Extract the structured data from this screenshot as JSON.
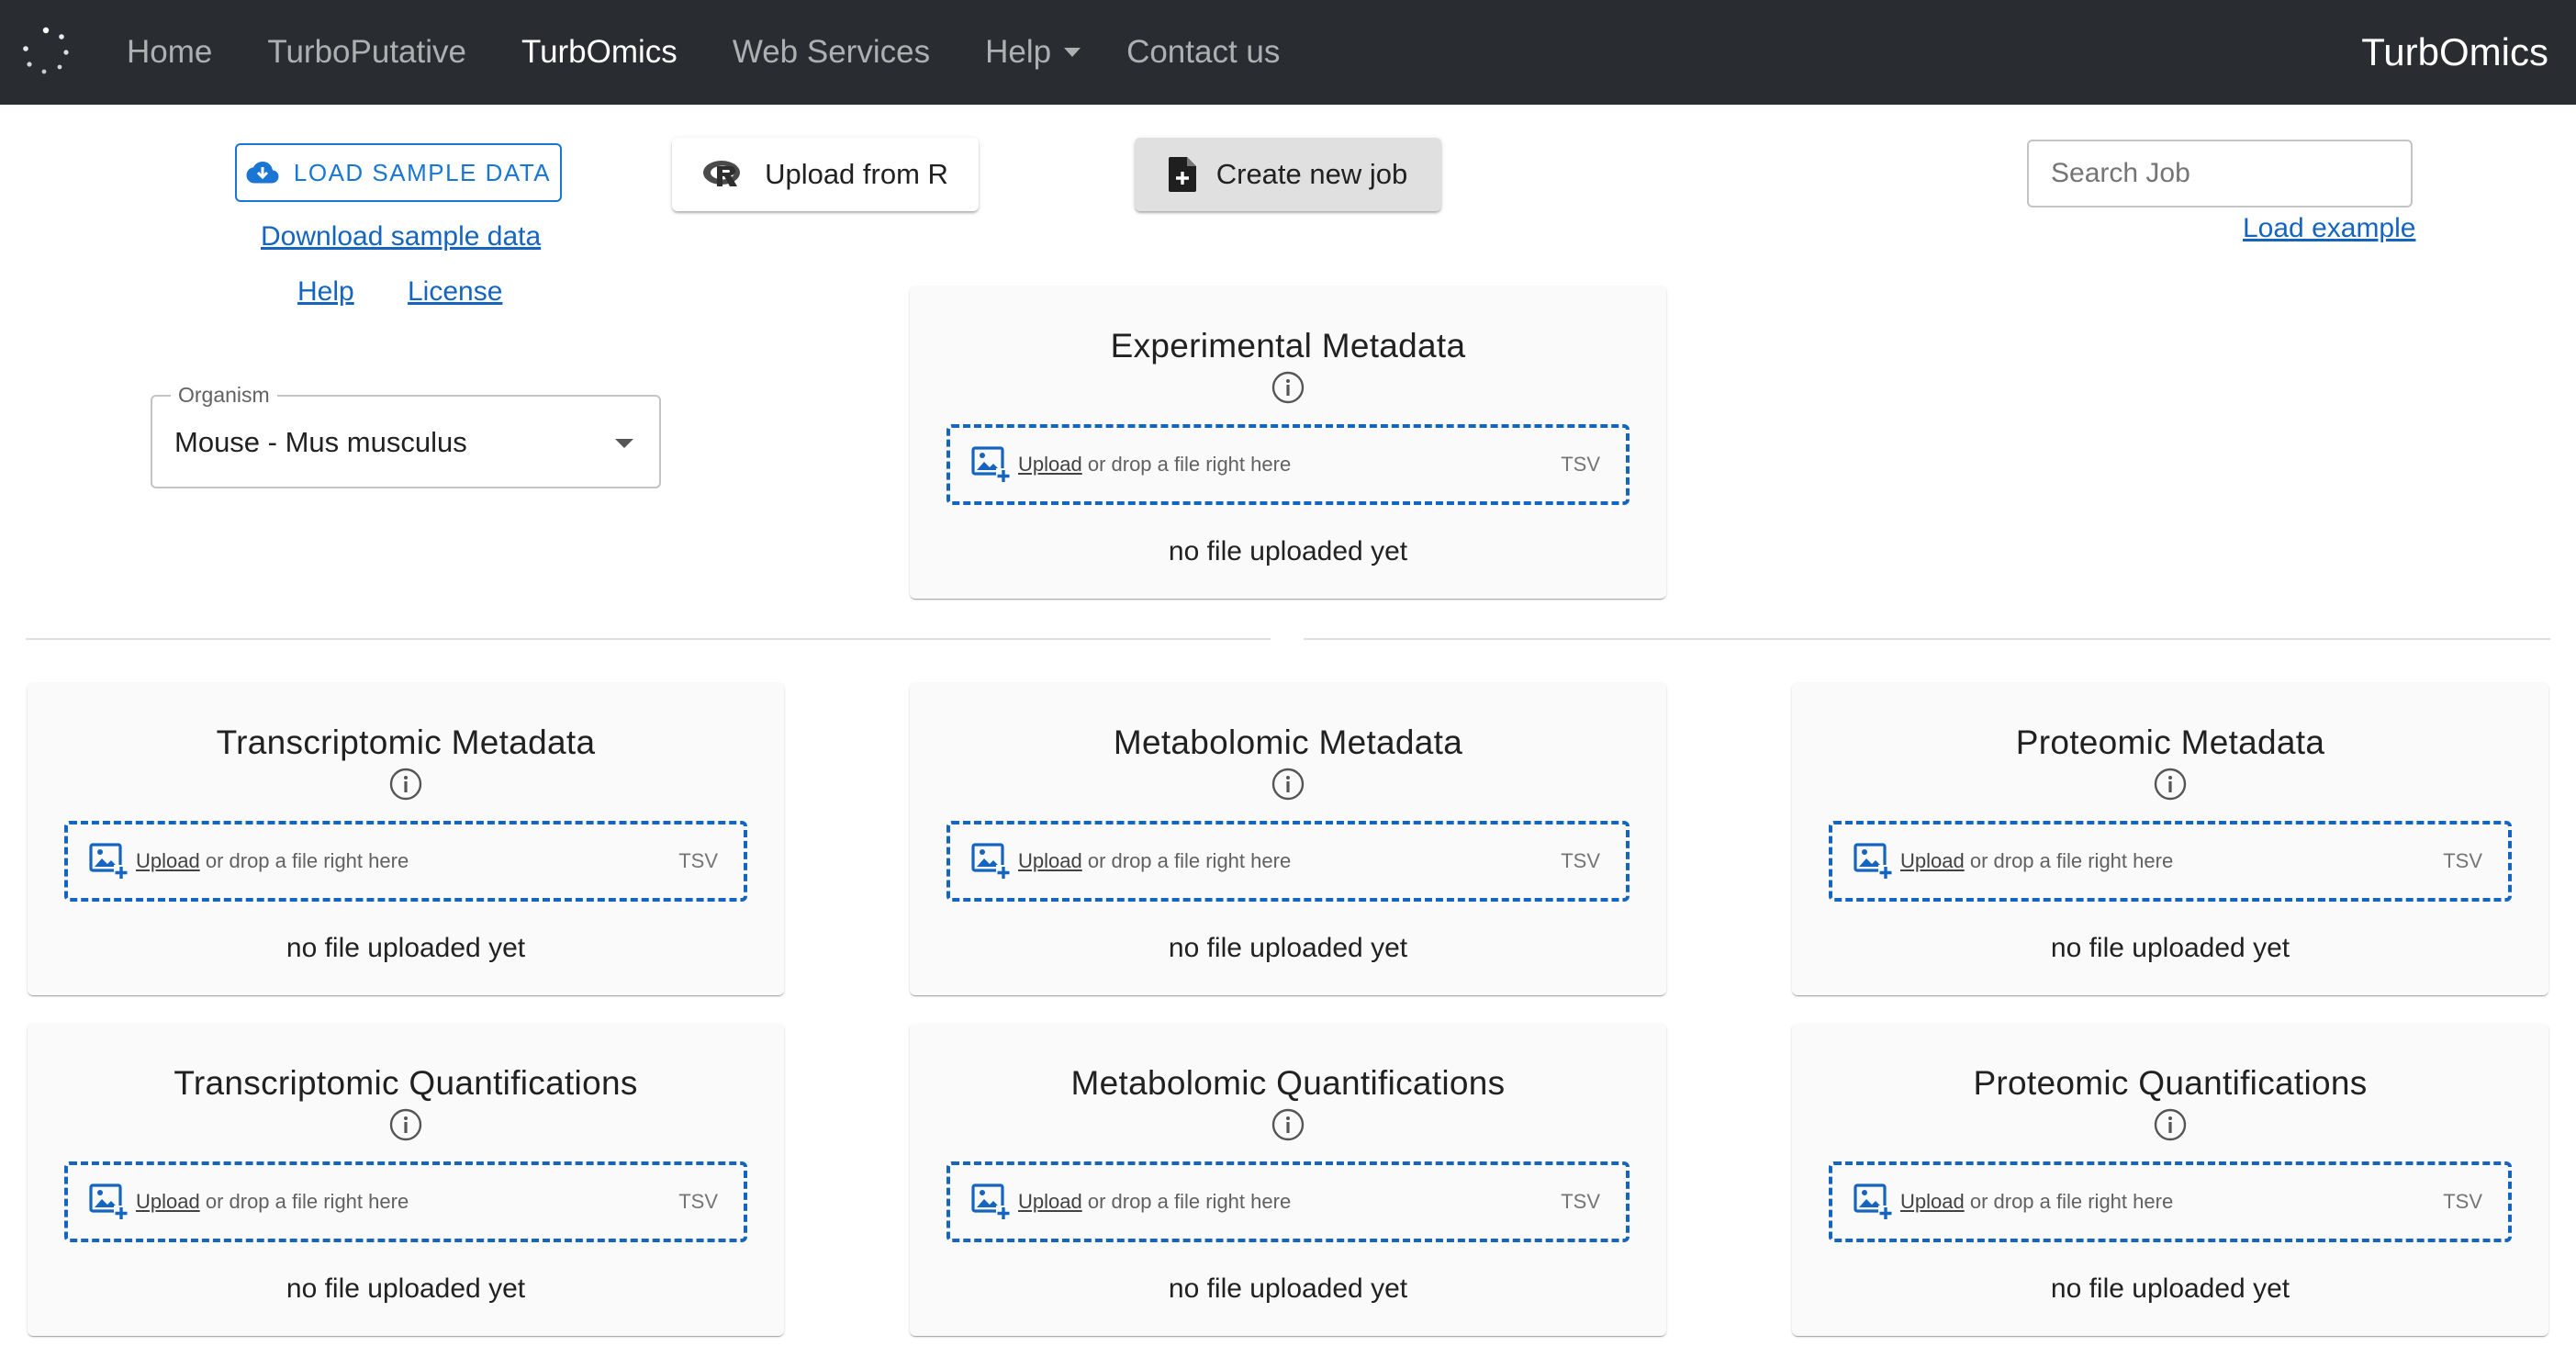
{
  "nav": {
    "links": [
      "Home",
      "TurboPutative",
      "TurbOmics",
      "Web Services",
      "Help",
      "Contact us"
    ],
    "brand": "TurbOmics"
  },
  "controls": {
    "load_sample": "LOAD SAMPLE DATA",
    "download_sample": "Download sample data",
    "help": "Help",
    "license": "License",
    "upload_r": "Upload from R",
    "create_job": "Create new job",
    "search_placeholder": "Search Job",
    "load_example": "Load example"
  },
  "organism": {
    "label": "Organism",
    "value": "Mouse - Mus musculus"
  },
  "dropzone": {
    "upload_link": "Upload",
    "text": " or drop a file right here",
    "type": "TSV"
  },
  "cards": [
    {
      "title": "Experimental Metadata",
      "status": "no file uploaded yet"
    },
    {
      "title": "Transcriptomic Metadata",
      "status": "no file uploaded yet"
    },
    {
      "title": "Metabolomic Metadata",
      "status": "no file uploaded yet"
    },
    {
      "title": "Proteomic Metadata",
      "status": "no file uploaded yet"
    },
    {
      "title": "Transcriptomic Quantifications",
      "status": "no file uploaded yet"
    },
    {
      "title": "Metabolomic Quantifications",
      "status": "no file uploaded yet"
    },
    {
      "title": "Proteomic Quantifications",
      "status": "no file uploaded yet"
    }
  ],
  "colors": {
    "navbar": "#292d32",
    "primary": "#1976d2",
    "dropzone_border": "#1565c0",
    "card_bg": "#fafafa"
  }
}
